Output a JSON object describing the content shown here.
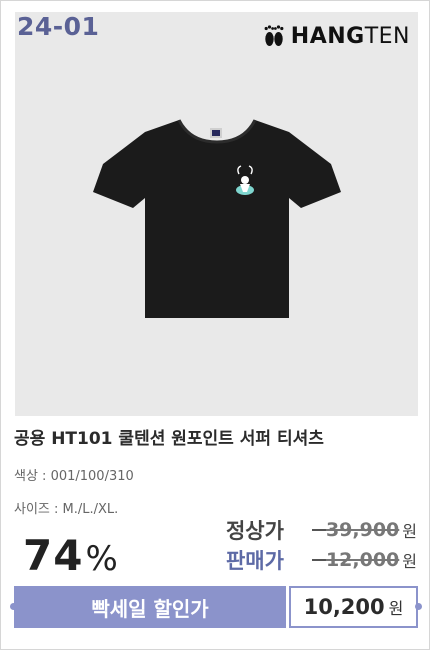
{
  "product": {
    "code": "24-01",
    "brand": "HANGTEN",
    "brand_part1": "HANG",
    "brand_part2": "TEN",
    "title": "공용 HT101 쿨텐션 원포인트 서퍼 티셔츠",
    "color_line": "색상 : 001/100/310",
    "size_line": "사이즈 : M./L./XL.",
    "shirt_color": "#1b1b1b",
    "print_color": "#7fd6cf"
  },
  "pricing": {
    "discount_value": "74",
    "discount_symbol": "%",
    "regular_label": "정상가",
    "regular_price": "39,900",
    "regular_unit": "원",
    "sale_label": "판매가",
    "sale_price": "12,000",
    "sale_unit": "원"
  },
  "banner": {
    "label": "빡세일 할인가",
    "final_price": "10,200",
    "final_unit": "원",
    "accent": "#8b93cb"
  }
}
